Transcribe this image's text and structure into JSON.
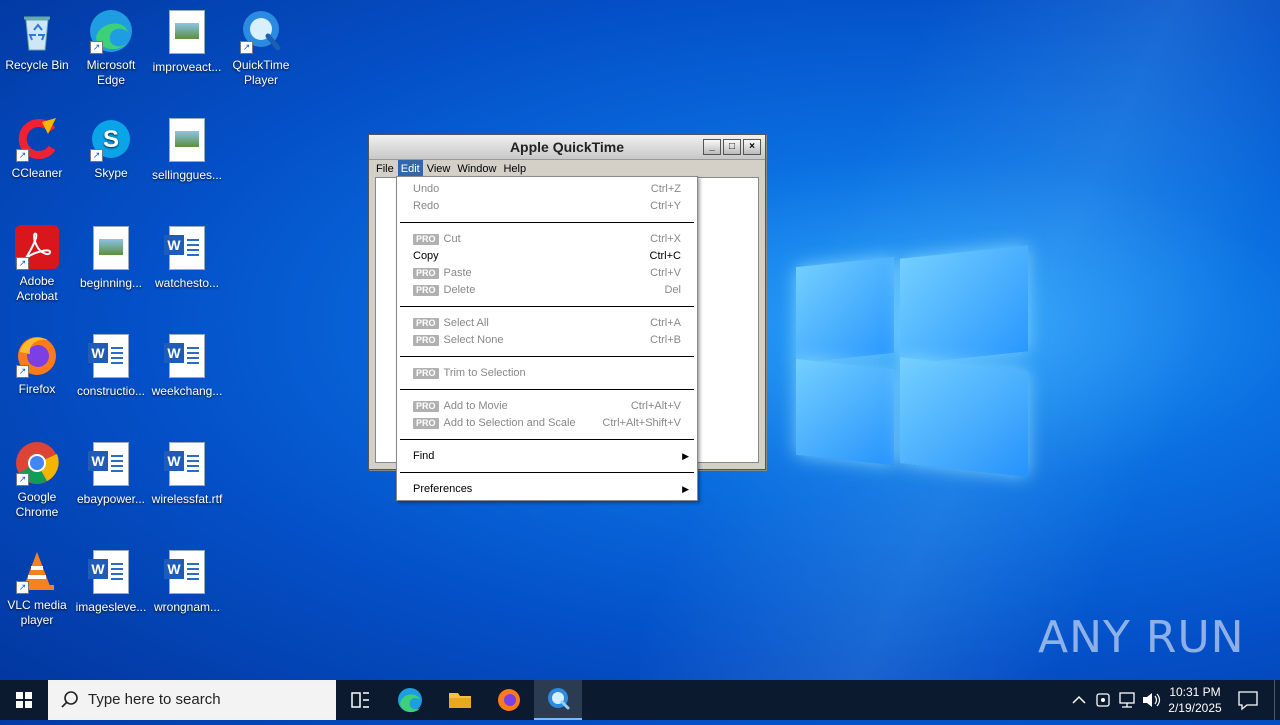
{
  "desktop": {
    "icons": [
      {
        "label": "Recycle Bin"
      },
      {
        "label": "Microsoft Edge"
      },
      {
        "label": "improveact..."
      },
      {
        "label": "QuickTime Player"
      },
      {
        "label": "CCleaner"
      },
      {
        "label": "Skype"
      },
      {
        "label": "sellinggues..."
      },
      {
        "label": "Adobe Acrobat"
      },
      {
        "label": "beginning..."
      },
      {
        "label": "watchesto..."
      },
      {
        "label": "Firefox"
      },
      {
        "label": "constructio..."
      },
      {
        "label": "weekchang..."
      },
      {
        "label": "Google Chrome"
      },
      {
        "label": "ebaypower..."
      },
      {
        "label": "wirelessfat.rtf"
      },
      {
        "label": "VLC media player"
      },
      {
        "label": "imagesleve..."
      },
      {
        "label": "wrongnam..."
      }
    ]
  },
  "qt_window": {
    "title": "Apple QuickTime",
    "menu": [
      "File",
      "Edit",
      "View",
      "Window",
      "Help"
    ],
    "active_menu": "Edit"
  },
  "edit_menu": {
    "pro_badge": "PRO",
    "items": {
      "undo": {
        "label": "Undo",
        "shortcut": "Ctrl+Z"
      },
      "redo": {
        "label": "Redo",
        "shortcut": "Ctrl+Y"
      },
      "cut": {
        "label": "Cut",
        "shortcut": "Ctrl+X"
      },
      "copy": {
        "label": "Copy",
        "shortcut": "Ctrl+C"
      },
      "paste": {
        "label": "Paste",
        "shortcut": "Ctrl+V"
      },
      "delete": {
        "label": "Delete",
        "shortcut": "Del"
      },
      "select_all": {
        "label": "Select All",
        "shortcut": "Ctrl+A"
      },
      "select_none": {
        "label": "Select None",
        "shortcut": "Ctrl+B"
      },
      "trim": {
        "label": "Trim to Selection"
      },
      "add_to_movie": {
        "label": "Add to Movie",
        "shortcut": "Ctrl+Alt+V"
      },
      "add_scale": {
        "label": "Add to Selection and Scale",
        "shortcut": "Ctrl+Alt+Shift+V"
      },
      "find": {
        "label": "Find"
      },
      "preferences": {
        "label": "Preferences"
      }
    }
  },
  "watermark": "ANY RUN",
  "taskbar": {
    "search_placeholder": "Type here to search",
    "time": "10:31 PM",
    "date": "2/19/2025"
  },
  "colors": {
    "menu_highlight": "#3366aa",
    "taskbar": "#0b1a2e",
    "desktop": "#0a6fe0"
  }
}
